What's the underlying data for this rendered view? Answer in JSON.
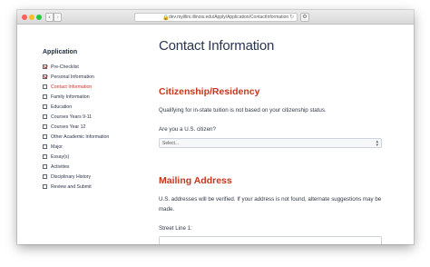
{
  "browser": {
    "url": "dev.myillini.illinois.edu/Apply/Application/ContactInformation",
    "back_glyph": "‹",
    "forward_glyph": "›",
    "reload_glyph": "↻",
    "lock_glyph": "🔒",
    "extension_glyph": "⚙"
  },
  "sidebar": {
    "title": "Application",
    "items": [
      {
        "label": "Pre-Checklist",
        "checked": true,
        "active": false
      },
      {
        "label": "Personal Information",
        "checked": true,
        "active": false
      },
      {
        "label": "Contact Information",
        "checked": false,
        "active": true
      },
      {
        "label": "Family Information",
        "checked": false,
        "active": false
      },
      {
        "label": "Education",
        "checked": false,
        "active": false
      },
      {
        "label": "Courses Years 9-11",
        "checked": false,
        "active": false
      },
      {
        "label": "Courses Year 12",
        "checked": false,
        "active": false
      },
      {
        "label": "Other Academic Information",
        "checked": false,
        "active": false
      },
      {
        "label": "Major",
        "checked": false,
        "active": false
      },
      {
        "label": "Essay(s)",
        "checked": false,
        "active": false
      },
      {
        "label": "Activities",
        "checked": false,
        "active": false
      },
      {
        "label": "Disciplinary History",
        "checked": false,
        "active": false
      },
      {
        "label": "Review and Submit",
        "checked": false,
        "active": false
      }
    ]
  },
  "main": {
    "page_title": "Contact Information",
    "citizenship": {
      "heading": "Citizenship/Residency",
      "intro": "Qualifying for in-state tuition is not based on your citizenship status.",
      "question": "Are you a U.S. citizen?",
      "select_value": "Select..."
    },
    "mailing": {
      "heading": "Mailing Address",
      "intro": "U.S. addresses will be verified. If your address is not found, alternate suggestions may be made.",
      "street_label": "Street Line 1:",
      "street_value": ""
    }
  },
  "colors": {
    "accent": "#c7371c",
    "navy": "#2a3550",
    "check": "#c0392b"
  }
}
